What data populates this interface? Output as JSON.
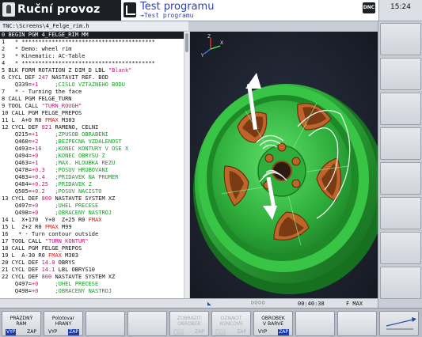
{
  "header": {
    "mode_title": "Ruční provoz",
    "program_title": "Test programu",
    "program_subtitle": "Test programu",
    "dnc_label": "DNC",
    "time": "15:24"
  },
  "path": "TNC:\\Screens\\4_Felge_rim.h",
  "listing": [
    {
      "n": "0",
      "t": "BEGIN PGM 4_FELGE_RIM MM",
      "sel": true
    },
    {
      "n": "1",
      "t": "  * ****************************************"
    },
    {
      "n": "2",
      "t": "  * Demo: wheel rim"
    },
    {
      "n": "3",
      "t": "  * Kinematic: AC-Table"
    },
    {
      "n": "4",
      "t": "  * ****************************************"
    },
    {
      "n": "5",
      "t": "BLK FORM ROTATION Z DIM_D LBL \"Blank\""
    },
    {
      "n": "6",
      "t": "CYCL DEF 247 NASTAVIT REF. BOD"
    },
    {
      "n": "",
      "t": "   Q339=+1     ;CISLO VZTAZNEHO BODU"
    },
    {
      "n": "7",
      "t": "  * - Turning the face"
    },
    {
      "n": "8",
      "t": "CALL PGM FELGE_TURN"
    },
    {
      "n": "9",
      "t": "TOOL CALL \"TURN_ROUGH\""
    },
    {
      "n": "10",
      "t": "CALL PGM FELGE_PREPOS"
    },
    {
      "n": "11",
      "t": "L  A+0 R0 FMAX M303"
    },
    {
      "n": "12",
      "t": "CYCL DEF 821 RAMENO, CELNI"
    },
    {
      "n": "",
      "t": "   Q215=+1     ;ZPUSOB OBRABENI"
    },
    {
      "n": "",
      "t": "   Q460=+2     ;BEZPECNA VZDALENOST"
    },
    {
      "n": "",
      "t": "   Q493=+16    ;KONEC KONTURY V OSE X"
    },
    {
      "n": "",
      "t": "   Q494=+0     ;KONEC OBRYSU Z"
    },
    {
      "n": "",
      "t": "   Q463=+1     ;MAX. HLOUBKA REZU"
    },
    {
      "n": "",
      "t": "   Q478=+0.3   ;POSUV HRUBOVANI"
    },
    {
      "n": "",
      "t": "   Q483=+0.4   ;PRIDAVEK NA PRUMER"
    },
    {
      "n": "",
      "t": "   Q484=+0.25  ;PRIDAVEK Z"
    },
    {
      "n": "",
      "t": "   Q505=+0.2   ;POSUV NACISTO"
    },
    {
      "n": "13",
      "t": "CYCL DEF 800 NASTAVTE SYSTEM XZ"
    },
    {
      "n": "",
      "t": "   Q497=+0     ;UHEL PRECESE"
    },
    {
      "n": "",
      "t": "   Q498=+0     ;OBRACENY NASTROJ"
    },
    {
      "n": "14",
      "t": "L  X+170  Y+0  Z+25 R0 FMAX"
    },
    {
      "n": "15",
      "t": "L  Z+2 R0 FMAX M99"
    },
    {
      "n": "16",
      "t": "  * - Turn contour outside"
    },
    {
      "n": "17",
      "t": "TOOL CALL \"TURN_KONTUR\""
    },
    {
      "n": "18",
      "t": "CALL PGM FELGE_PREPOS"
    },
    {
      "n": "19",
      "t": "L  A-30 R0 FMAX M303"
    },
    {
      "n": "20",
      "t": "CYCL DEF 14.0 OBRYS"
    },
    {
      "n": "21",
      "t": "CYCL DEF 14.1 LBL OBRYS10"
    },
    {
      "n": "22",
      "t": "CYCL DEF 800 NASTAVTE SYSTEM XZ"
    },
    {
      "n": "",
      "t": "   Q497=+0     ;UHEL PRECESE"
    },
    {
      "n": "",
      "t": "   Q498=+0     ;OBRACENY NASTROJ"
    }
  ],
  "sim_status": {
    "time": "00:40:38",
    "feed": "F MAX"
  },
  "softkeys": [
    {
      "l1": "PRÁZDNÝ",
      "l2": "RÁM",
      "vyp": "VYP",
      "zap": "ZAP",
      "on": "vyp",
      "disabled": false
    },
    {
      "l1": "Polotovar",
      "l2": "HRANY",
      "vyp": "VYP",
      "zap": "ZAP",
      "on": "zap",
      "disabled": false
    },
    {
      "l1": "",
      "l2": "",
      "vyp": "",
      "zap": "",
      "on": "",
      "disabled": false
    },
    {
      "l1": "",
      "l2": "",
      "vyp": "",
      "zap": "",
      "on": "",
      "disabled": false
    },
    {
      "l1": "ZOBRAZIT",
      "l2": "OBROBEK",
      "vyp": "VYP",
      "zap": "ZAP",
      "on": "vyp",
      "disabled": true
    },
    {
      "l1": "OZNACIT",
      "l2": "KONCOVE",
      "vyp": "VYP",
      "zap": "ZAP",
      "on": "vyp",
      "disabled": true
    },
    {
      "l1": "OBROBEK",
      "l2": "V BARVE",
      "vyp": "VYP",
      "zap": "ZAP",
      "on": "zap",
      "disabled": false
    },
    {
      "l1": "",
      "l2": "",
      "vyp": "",
      "zap": "",
      "on": "",
      "disabled": false
    },
    {
      "l1": "",
      "l2": "",
      "vyp": "",
      "zap": "",
      "on": "",
      "disabled": false
    }
  ],
  "colors": {
    "header_dark": "#1c1f24",
    "program_title": "#2a3fb8",
    "wheel_green": "#2fae3c",
    "wheel_copper": "#c0652a",
    "toggle_on": "#1a3bb8"
  }
}
